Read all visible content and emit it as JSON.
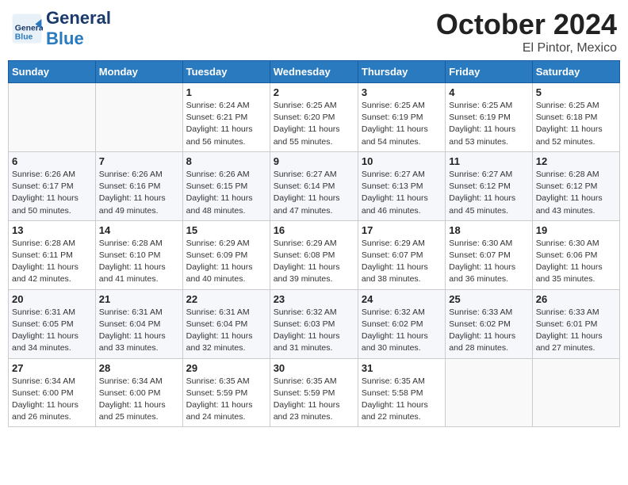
{
  "header": {
    "logo_general": "General",
    "logo_blue": "Blue",
    "month_title": "October 2024",
    "location": "El Pintor, Mexico"
  },
  "weekdays": [
    "Sunday",
    "Monday",
    "Tuesday",
    "Wednesday",
    "Thursday",
    "Friday",
    "Saturday"
  ],
  "weeks": [
    [
      {
        "day": "",
        "info": ""
      },
      {
        "day": "",
        "info": ""
      },
      {
        "day": "1",
        "info": "Sunrise: 6:24 AM\nSunset: 6:21 PM\nDaylight: 11 hours and 56 minutes."
      },
      {
        "day": "2",
        "info": "Sunrise: 6:25 AM\nSunset: 6:20 PM\nDaylight: 11 hours and 55 minutes."
      },
      {
        "day": "3",
        "info": "Sunrise: 6:25 AM\nSunset: 6:19 PM\nDaylight: 11 hours and 54 minutes."
      },
      {
        "day": "4",
        "info": "Sunrise: 6:25 AM\nSunset: 6:19 PM\nDaylight: 11 hours and 53 minutes."
      },
      {
        "day": "5",
        "info": "Sunrise: 6:25 AM\nSunset: 6:18 PM\nDaylight: 11 hours and 52 minutes."
      }
    ],
    [
      {
        "day": "6",
        "info": "Sunrise: 6:26 AM\nSunset: 6:17 PM\nDaylight: 11 hours and 50 minutes."
      },
      {
        "day": "7",
        "info": "Sunrise: 6:26 AM\nSunset: 6:16 PM\nDaylight: 11 hours and 49 minutes."
      },
      {
        "day": "8",
        "info": "Sunrise: 6:26 AM\nSunset: 6:15 PM\nDaylight: 11 hours and 48 minutes."
      },
      {
        "day": "9",
        "info": "Sunrise: 6:27 AM\nSunset: 6:14 PM\nDaylight: 11 hours and 47 minutes."
      },
      {
        "day": "10",
        "info": "Sunrise: 6:27 AM\nSunset: 6:13 PM\nDaylight: 11 hours and 46 minutes."
      },
      {
        "day": "11",
        "info": "Sunrise: 6:27 AM\nSunset: 6:12 PM\nDaylight: 11 hours and 45 minutes."
      },
      {
        "day": "12",
        "info": "Sunrise: 6:28 AM\nSunset: 6:12 PM\nDaylight: 11 hours and 43 minutes."
      }
    ],
    [
      {
        "day": "13",
        "info": "Sunrise: 6:28 AM\nSunset: 6:11 PM\nDaylight: 11 hours and 42 minutes."
      },
      {
        "day": "14",
        "info": "Sunrise: 6:28 AM\nSunset: 6:10 PM\nDaylight: 11 hours and 41 minutes."
      },
      {
        "day": "15",
        "info": "Sunrise: 6:29 AM\nSunset: 6:09 PM\nDaylight: 11 hours and 40 minutes."
      },
      {
        "day": "16",
        "info": "Sunrise: 6:29 AM\nSunset: 6:08 PM\nDaylight: 11 hours and 39 minutes."
      },
      {
        "day": "17",
        "info": "Sunrise: 6:29 AM\nSunset: 6:07 PM\nDaylight: 11 hours and 38 minutes."
      },
      {
        "day": "18",
        "info": "Sunrise: 6:30 AM\nSunset: 6:07 PM\nDaylight: 11 hours and 36 minutes."
      },
      {
        "day": "19",
        "info": "Sunrise: 6:30 AM\nSunset: 6:06 PM\nDaylight: 11 hours and 35 minutes."
      }
    ],
    [
      {
        "day": "20",
        "info": "Sunrise: 6:31 AM\nSunset: 6:05 PM\nDaylight: 11 hours and 34 minutes."
      },
      {
        "day": "21",
        "info": "Sunrise: 6:31 AM\nSunset: 6:04 PM\nDaylight: 11 hours and 33 minutes."
      },
      {
        "day": "22",
        "info": "Sunrise: 6:31 AM\nSunset: 6:04 PM\nDaylight: 11 hours and 32 minutes."
      },
      {
        "day": "23",
        "info": "Sunrise: 6:32 AM\nSunset: 6:03 PM\nDaylight: 11 hours and 31 minutes."
      },
      {
        "day": "24",
        "info": "Sunrise: 6:32 AM\nSunset: 6:02 PM\nDaylight: 11 hours and 30 minutes."
      },
      {
        "day": "25",
        "info": "Sunrise: 6:33 AM\nSunset: 6:02 PM\nDaylight: 11 hours and 28 minutes."
      },
      {
        "day": "26",
        "info": "Sunrise: 6:33 AM\nSunset: 6:01 PM\nDaylight: 11 hours and 27 minutes."
      }
    ],
    [
      {
        "day": "27",
        "info": "Sunrise: 6:34 AM\nSunset: 6:00 PM\nDaylight: 11 hours and 26 minutes."
      },
      {
        "day": "28",
        "info": "Sunrise: 6:34 AM\nSunset: 6:00 PM\nDaylight: 11 hours and 25 minutes."
      },
      {
        "day": "29",
        "info": "Sunrise: 6:35 AM\nSunset: 5:59 PM\nDaylight: 11 hours and 24 minutes."
      },
      {
        "day": "30",
        "info": "Sunrise: 6:35 AM\nSunset: 5:59 PM\nDaylight: 11 hours and 23 minutes."
      },
      {
        "day": "31",
        "info": "Sunrise: 6:35 AM\nSunset: 5:58 PM\nDaylight: 11 hours and 22 minutes."
      },
      {
        "day": "",
        "info": ""
      },
      {
        "day": "",
        "info": ""
      }
    ]
  ]
}
